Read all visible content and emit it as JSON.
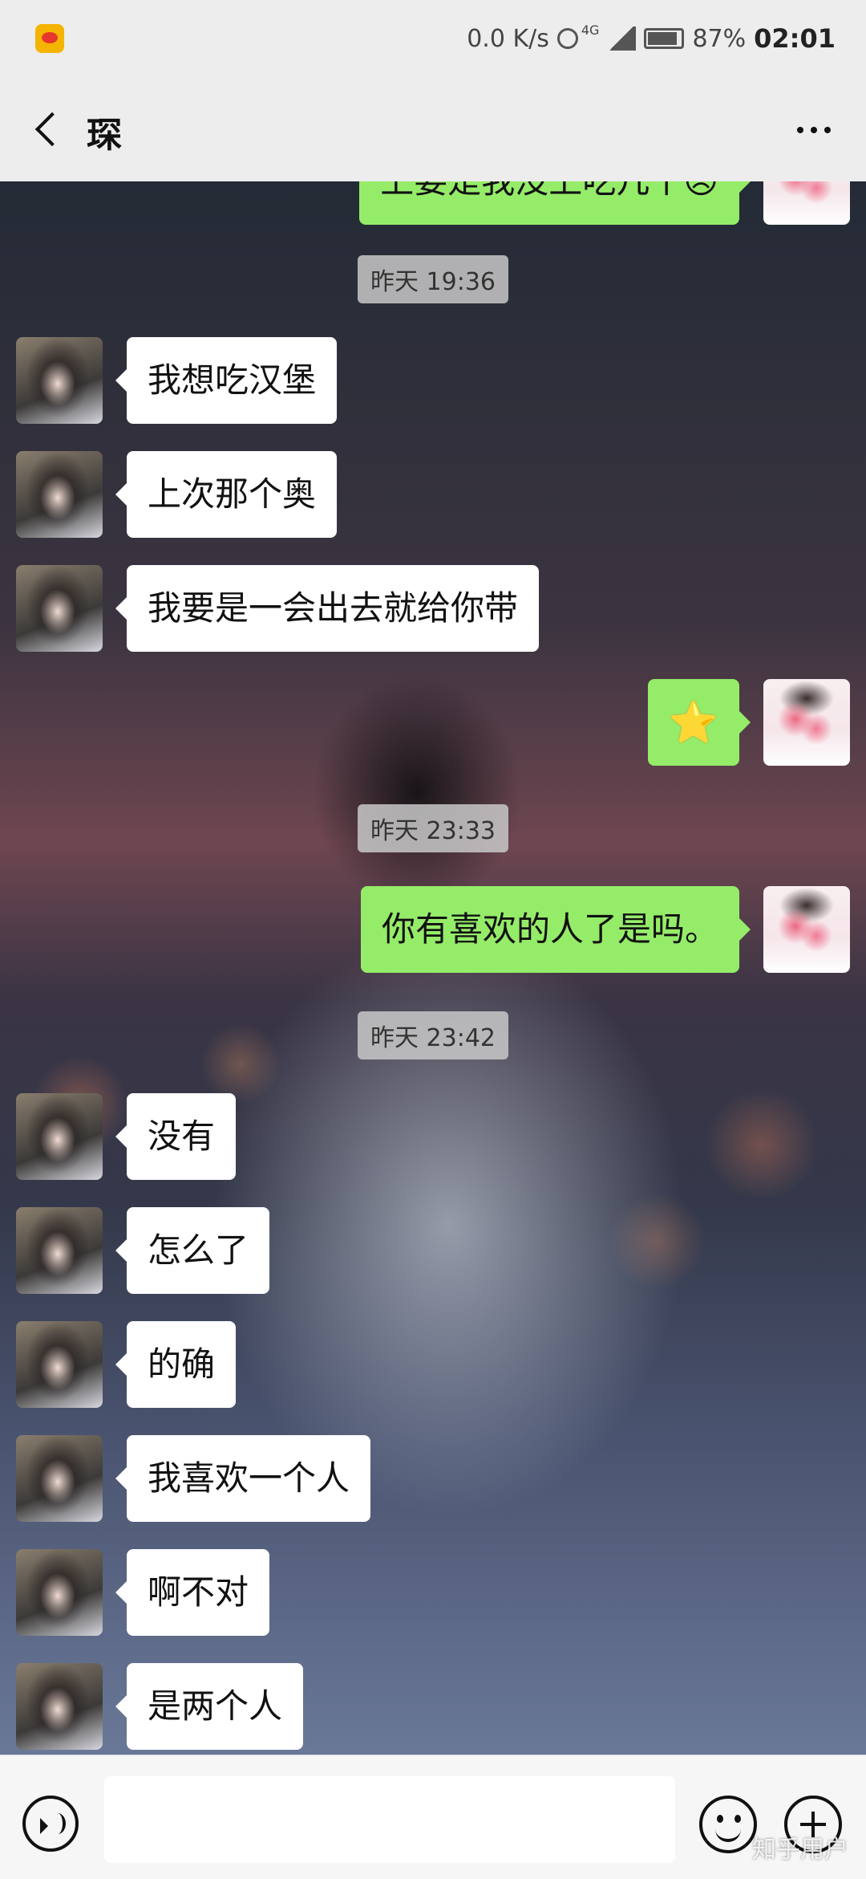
{
  "status_bar": {
    "network_speed": "0.0 K/s",
    "network_type": "4G",
    "battery": "87%",
    "time": "02:01"
  },
  "header": {
    "title": "琛"
  },
  "messages": [
    {
      "type": "outgoing",
      "text": "上要是我没上吃几个😣",
      "partial": true
    },
    {
      "type": "timestamp",
      "text": "昨天 19:36"
    },
    {
      "type": "incoming",
      "text": "我想吃汉堡"
    },
    {
      "type": "incoming",
      "text": "上次那个奥"
    },
    {
      "type": "incoming",
      "text": "我要是一会出去就给你带"
    },
    {
      "type": "outgoing",
      "text": "⭐",
      "sticker": "star-emoji"
    },
    {
      "type": "timestamp",
      "text": "昨天 23:33"
    },
    {
      "type": "outgoing",
      "text": "你有喜欢的人了是吗。"
    },
    {
      "type": "timestamp",
      "text": "昨天 23:42"
    },
    {
      "type": "incoming",
      "text": "没有"
    },
    {
      "type": "incoming",
      "text": "怎么了"
    },
    {
      "type": "incoming",
      "text": "的确"
    },
    {
      "type": "incoming",
      "text": "我喜欢一个人"
    },
    {
      "type": "incoming",
      "text": "啊不对"
    },
    {
      "type": "incoming",
      "text": "是两个人"
    }
  ],
  "input_bar": {
    "value": "",
    "icons": [
      "voice-icon",
      "emoji-icon",
      "plus-icon"
    ]
  },
  "watermark": "知乎用户",
  "colors": {
    "outgoing_bubble": "#95ec69",
    "incoming_bubble": "#ffffff",
    "header_bg": "#ededed"
  }
}
